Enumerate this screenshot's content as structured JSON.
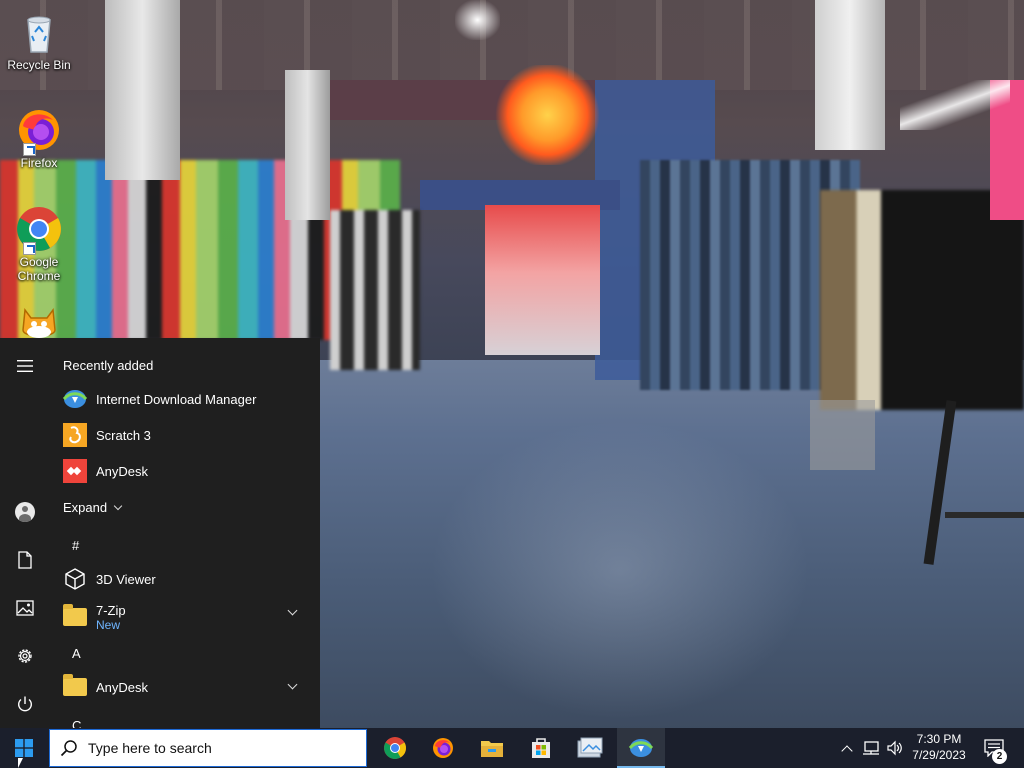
{
  "desktop": {
    "icons": [
      {
        "label": "Recycle Bin",
        "icon": "recycle-bin-icon"
      },
      {
        "label": "Firefox",
        "icon": "firefox-icon"
      },
      {
        "label": "Google Chrome",
        "icon": "chrome-icon"
      },
      {
        "label": "",
        "icon": "scratch-icon"
      }
    ]
  },
  "start_menu": {
    "recently_added_title": "Recently added",
    "recent": [
      {
        "label": "Internet Download Manager",
        "icon": "idm-icon"
      },
      {
        "label": "Scratch 3",
        "icon": "scratch-icon"
      },
      {
        "label": "AnyDesk",
        "icon": "anydesk-icon"
      }
    ],
    "expand_label": "Expand",
    "groups": [
      {
        "letter": "#"
      },
      {
        "letter": "A"
      },
      {
        "letter": "C"
      }
    ],
    "apps": [
      {
        "label": "3D Viewer",
        "icon": "cube-icon"
      },
      {
        "label": "7-Zip",
        "sublabel": "New",
        "icon": "folder-icon"
      },
      {
        "label": "AnyDesk",
        "icon": "folder-icon"
      }
    ],
    "rail": [
      "hamburger-icon",
      "user-icon",
      "document-icon",
      "pictures-icon",
      "settings-icon",
      "power-icon"
    ]
  },
  "taskbar": {
    "search_placeholder": "Type here to search",
    "pinned": [
      "chrome-icon",
      "firefox-icon",
      "file-explorer-icon",
      "store-icon",
      "photos-icon",
      "idm-icon"
    ],
    "clock_time": "7:30 PM",
    "clock_date": "7/29/2023",
    "notification_count": "2"
  },
  "colors": {
    "taskbar_bg": "#1b1f2c",
    "start_menu_bg": "#1f1f1f",
    "accent": "#76b9ed",
    "new_badge": "#6fb5ff"
  }
}
